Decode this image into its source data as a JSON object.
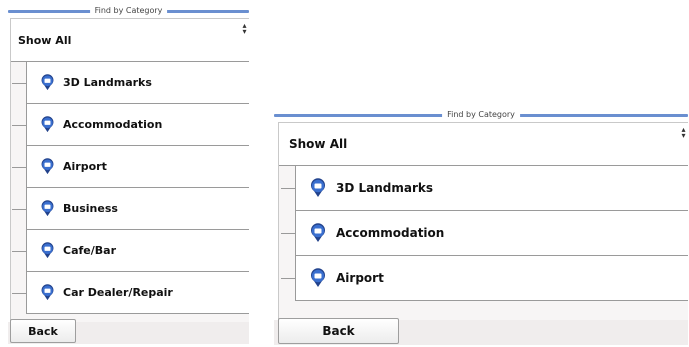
{
  "colors": {
    "accent": "#6a8fd0",
    "pin": "#3a6fcf",
    "pin_dark": "#22428b"
  },
  "screens": [
    {
      "header": {
        "title": "Find by Category"
      },
      "show_all_label": "Show All",
      "categories": [
        {
          "label": "3D Landmarks",
          "icon": "landmark-icon"
        },
        {
          "label": "Accommodation",
          "icon": "bed-icon"
        },
        {
          "label": "Airport",
          "icon": "airplane-icon"
        },
        {
          "label": "Business",
          "icon": "business-icon"
        },
        {
          "label": "Cafe/Bar",
          "icon": "cup-icon"
        },
        {
          "label": "Car Dealer/Repair",
          "icon": "car-icon"
        }
      ],
      "back_label": "Back"
    },
    {
      "header": {
        "title": "Find by Category"
      },
      "show_all_label": "Show All",
      "categories": [
        {
          "label": "3D Landmarks",
          "icon": "landmark-icon"
        },
        {
          "label": "Accommodation",
          "icon": "bed-icon"
        },
        {
          "label": "Airport",
          "icon": "airplane-icon"
        }
      ],
      "back_label": "Back"
    }
  ]
}
